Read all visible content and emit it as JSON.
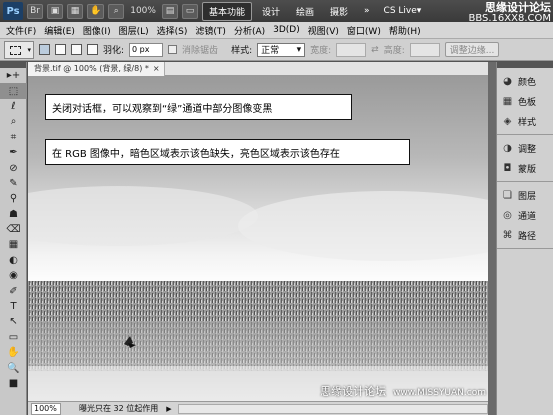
{
  "appbar": {
    "logo": "Ps",
    "zoom": "100%",
    "workspaces": [
      {
        "label": "基本功能",
        "active": true
      },
      {
        "label": "设计",
        "active": false
      },
      {
        "label": "绘画",
        "active": false
      },
      {
        "label": "摄影",
        "active": false
      },
      {
        "label": "»",
        "active": false
      }
    ],
    "cs_live": "CS Live▾",
    "watermark_line1": "思缘设计论坛",
    "watermark_line2": "BBS.16XX8.COM"
  },
  "menubar": {
    "items": [
      "文件(F)",
      "编辑(E)",
      "图像(I)",
      "图层(L)",
      "选择(S)",
      "滤镜(T)",
      "分析(A)",
      "3D(D)",
      "视图(V)",
      "窗口(W)",
      "帮助(H)"
    ]
  },
  "options": {
    "feather_label": "羽化:",
    "feather_value": "0 px",
    "antialias_label": "消除锯齿",
    "style_label": "样式:",
    "style_value": "正常",
    "width_label": "宽度:",
    "height_label": "高度:",
    "refine_edge": "调整边缘..."
  },
  "tools": [
    "▸+",
    "⬚",
    "ℓ",
    "⌕",
    "⌗",
    "✒",
    "⊘",
    "✎",
    "⚲",
    "☗",
    "⌫",
    "▦",
    "◐",
    "◉",
    "✐",
    "T",
    "↖",
    "▭",
    "✋",
    "🔍",
    "■"
  ],
  "document": {
    "tab_title": "背景.tif @ 100% (背景, 绿/8) *",
    "close": "×",
    "note1": "关闭对话框，可以观察到“绿”通道中部分图像变黑",
    "note2": "在 RGB 图像中，暗色区域表示该色缺失，亮色区域表示该色存在",
    "zoom": "100%",
    "status_info": "曝光只在 32 位起作用",
    "status_arrow": "▶",
    "watermark_cn": "思缘设计论坛",
    "watermark_url": "www.MISSYUAN.com"
  },
  "panels": {
    "groups": [
      [
        {
          "icon": "palette-icon",
          "glyph": "◕",
          "label": "颜色"
        },
        {
          "icon": "swatches-icon",
          "glyph": "▦",
          "label": "色板"
        },
        {
          "icon": "styles-icon",
          "glyph": "◈",
          "label": "样式"
        }
      ],
      [
        {
          "icon": "adjustments-icon",
          "glyph": "◑",
          "label": "调整"
        },
        {
          "icon": "masks-icon",
          "glyph": "◘",
          "label": "蒙版"
        }
      ],
      [
        {
          "icon": "layers-icon",
          "glyph": "❏",
          "label": "图层"
        },
        {
          "icon": "channels-icon",
          "glyph": "◎",
          "label": "通道"
        },
        {
          "icon": "paths-icon",
          "glyph": "⌘",
          "label": "路径"
        }
      ]
    ]
  }
}
